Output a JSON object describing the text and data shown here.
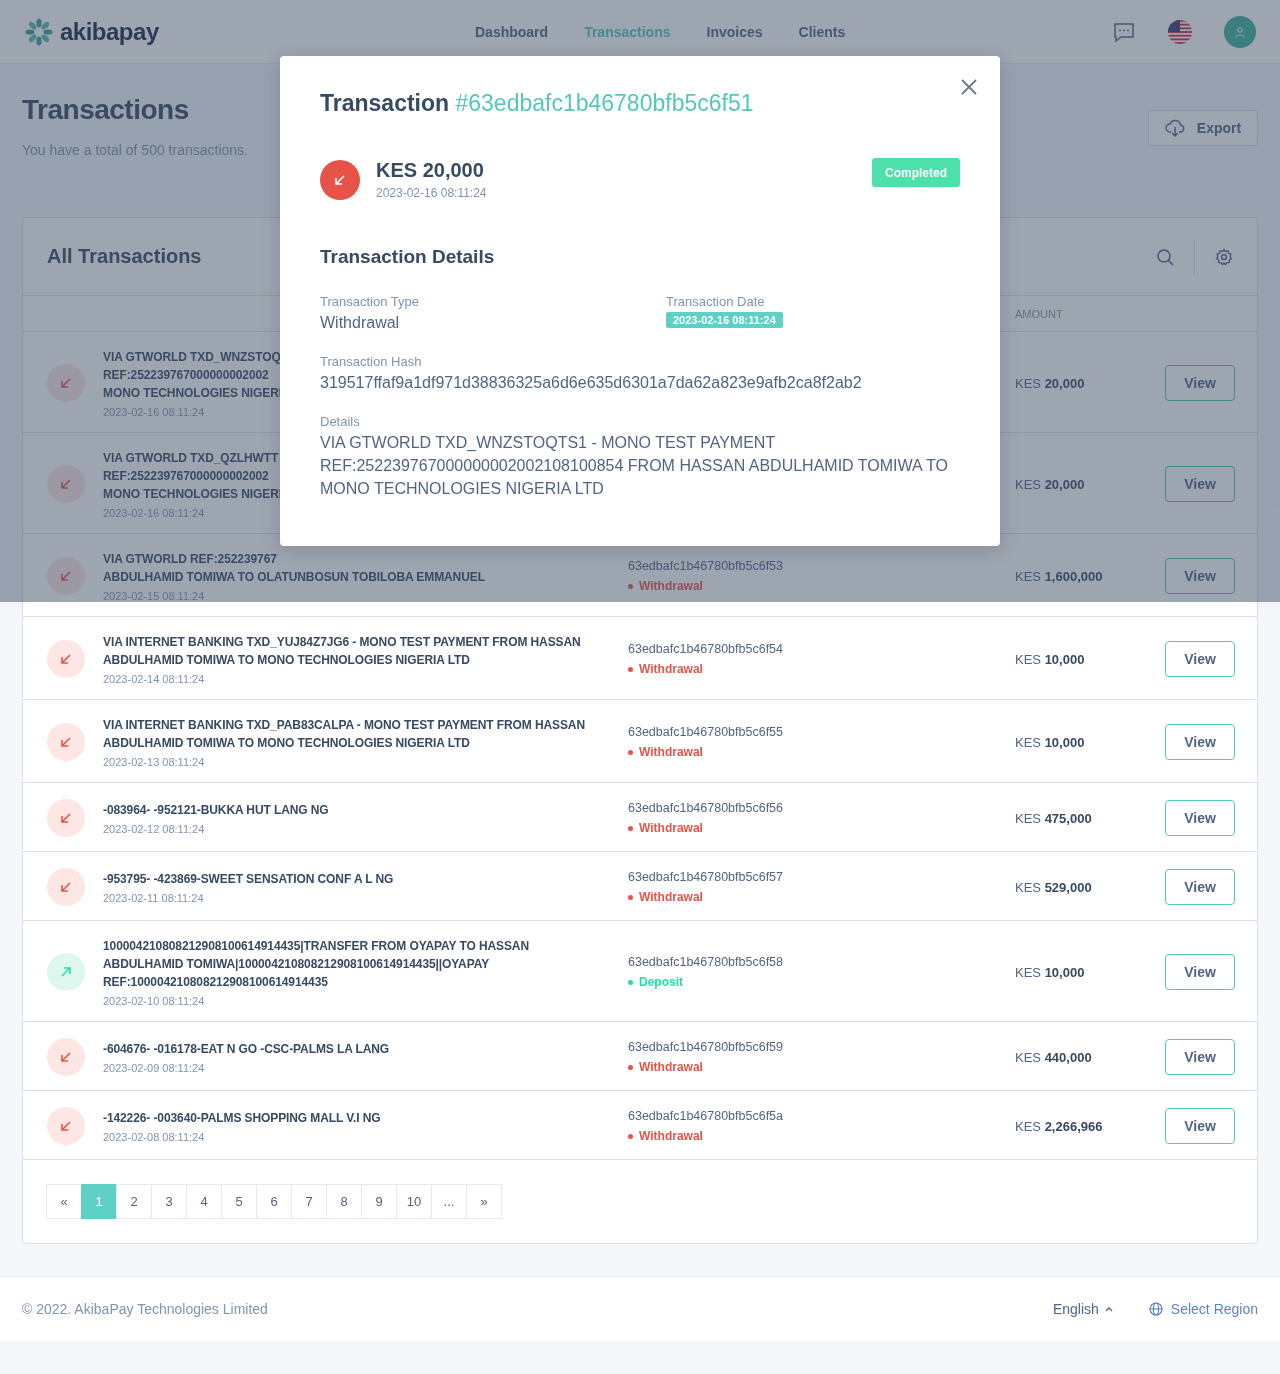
{
  "brand": {
    "name": "akibapay"
  },
  "nav": [
    {
      "label": "Dashboard",
      "selected": false
    },
    {
      "label": "Transactions",
      "selected": true
    },
    {
      "label": "Invoices",
      "selected": false
    },
    {
      "label": "Clients",
      "selected": false
    }
  ],
  "page": {
    "title": "Transactions",
    "subtitle": "You have a total of 500 transactions.",
    "export_button": "Export"
  },
  "card": {
    "title": "All Transactions",
    "amount_column": "AMOUNT"
  },
  "rows": [
    {
      "kind": "withdrawal",
      "description_lines": [
        "VIA GTWORLD TXD_WNZSTOQ",
        "REF:252239767000000002002",
        "MONO TECHNOLOGIES NIGERI"
      ],
      "date": "2023-02-16 08:11:24",
      "currency": "KES",
      "amount": "20,000",
      "action": "View"
    },
    {
      "kind": "withdrawal",
      "description_lines": [
        "VIA GTWORLD TXD_QZLHWTT",
        "REF:252239767000000002002",
        "MONO TECHNOLOGIES NIGERI"
      ],
      "date": "2023-02-16 08:11:24",
      "currency": "KES",
      "amount": "20,000",
      "action": "View"
    },
    {
      "kind": "withdrawal",
      "description_lines": [
        "VIA GTWORLD REF:252239767",
        "ABDULHAMID TOMIWA TO OLATUNBOSUN TOBILOBA EMMANUEL"
      ],
      "date": "2023-02-15 08:11:24",
      "tx_id": "63edbafc1b46780bfb5c6f53",
      "type": "Withdrawal",
      "currency": "KES",
      "amount": "1,600,000",
      "action": "View"
    },
    {
      "kind": "withdrawal",
      "description": "VIA INTERNET BANKING TXD_YUJ84Z7JG6 - MONO TEST PAYMENT FROM HASSAN ABDULHAMID TOMIWA TO MONO TECHNOLOGIES NIGERIA LTD",
      "date": "2023-02-14 08:11:24",
      "tx_id": "63edbafc1b46780bfb5c6f54",
      "type": "Withdrawal",
      "currency": "KES",
      "amount": "10,000",
      "action": "View"
    },
    {
      "kind": "withdrawal",
      "description": "VIA INTERNET BANKING TXD_PAB83CALPA - MONO TEST PAYMENT FROM HASSAN ABDULHAMID TOMIWA TO MONO TECHNOLOGIES NIGERIA LTD",
      "date": "2023-02-13 08:11:24",
      "tx_id": "63edbafc1b46780bfb5c6f55",
      "type": "Withdrawal",
      "currency": "KES",
      "amount": "10,000",
      "action": "View"
    },
    {
      "kind": "withdrawal",
      "description": "-083964- -952121-BUKKA HUT LANG NG",
      "date": "2023-02-12 08:11:24",
      "tx_id": "63edbafc1b46780bfb5c6f56",
      "type": "Withdrawal",
      "currency": "KES",
      "amount": "475,000",
      "action": "View"
    },
    {
      "kind": "withdrawal",
      "description": "-953795- -423869-SWEET SENSATION CONF A L NG",
      "date": "2023-02-11 08:11:24",
      "tx_id": "63edbafc1b46780bfb5c6f57",
      "type": "Withdrawal",
      "currency": "KES",
      "amount": "529,000",
      "action": "View"
    },
    {
      "kind": "deposit",
      "description_lines": [
        "100004210808212908100614914435|TRANSFER FROM OYAPAY TO HASSAN",
        "ABDULHAMID TOMIWA|100004210808212908100614914435||OYAPAY",
        "REF:100004210808212908100614914435"
      ],
      "date": "2023-02-10 08:11:24",
      "tx_id": "63edbafc1b46780bfb5c6f58",
      "type": "Deposit",
      "currency": "KES",
      "amount": "10,000",
      "action": "View"
    },
    {
      "kind": "withdrawal",
      "description": "-604676- -016178-EAT N GO -CSC-PALMS LA LANG",
      "date": "2023-02-09 08:11:24",
      "tx_id": "63edbafc1b46780bfb5c6f59",
      "type": "Withdrawal",
      "currency": "KES",
      "amount": "440,000",
      "action": "View"
    },
    {
      "kind": "withdrawal",
      "description": "-142226- -003640-PALMS SHOPPING MALL V.I NG",
      "date": "2023-02-08 08:11:24",
      "tx_id": "63edbafc1b46780bfb5c6f5a",
      "type": "Withdrawal",
      "currency": "KES",
      "amount": "2,266,966",
      "action": "View"
    }
  ],
  "pagination": [
    {
      "label": "«",
      "selected": false
    },
    {
      "label": "1",
      "selected": true
    },
    {
      "label": "2",
      "selected": false
    },
    {
      "label": "3",
      "selected": false
    },
    {
      "label": "4",
      "selected": false
    },
    {
      "label": "5",
      "selected": false
    },
    {
      "label": "6",
      "selected": false
    },
    {
      "label": "7",
      "selected": false
    },
    {
      "label": "8",
      "selected": false
    },
    {
      "label": "9",
      "selected": false
    },
    {
      "label": "10",
      "selected": false
    },
    {
      "label": "...",
      "selected": false
    },
    {
      "label": "»",
      "selected": false
    }
  ],
  "footer": {
    "copyright": "© 2022. AkibaPay Technologies Limited",
    "language": "English",
    "region": "Select Region"
  },
  "modal": {
    "title": "Transaction",
    "tx_id": "#63edbafc1b46780bfb5c6f51",
    "kind": "withdrawal",
    "amount": "KES 20,000",
    "date": "2023-02-16 08:11:24",
    "status": "Completed",
    "section_title": "Transaction Details",
    "fields": [
      {
        "kind": "text",
        "label": "Transaction Type",
        "value": "Withdrawal"
      },
      {
        "kind": "badge",
        "label": "Transaction Date",
        "value": "2023-02-16 08:11:24"
      },
      {
        "kind": "long",
        "label": "Transaction Hash",
        "value": "319517ffaf9a1df971d38836325a6d6e635d6301a7da62a823e9afb2ca8f2ab2"
      },
      {
        "kind": "long",
        "label": "Details",
        "value": "VIA GTWORLD TXD_WNZSTOQTS1 - MONO TEST PAYMENT REF:252239767000000002002108100854 FROM HASSAN ABDULHAMID TOMIWA TO MONO TECHNOLOGIES NIGERIA LTD"
      }
    ]
  }
}
